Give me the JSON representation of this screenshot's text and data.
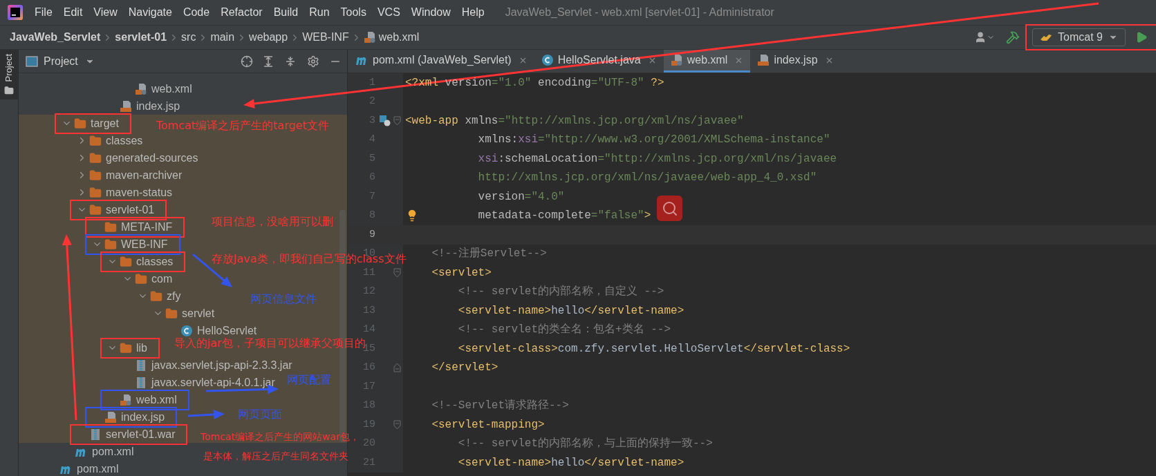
{
  "menu": [
    "File",
    "Edit",
    "View",
    "Navigate",
    "Code",
    "Refactor",
    "Build",
    "Run",
    "Tools",
    "VCS",
    "Window",
    "Help"
  ],
  "window": {
    "title": "JavaWeb_Servlet - web.xml [servlet-01] - Administrator"
  },
  "breadcrumb": [
    {
      "label": "JavaWeb_Servlet",
      "kind": "module"
    },
    {
      "label": "servlet-01",
      "kind": "module"
    },
    {
      "label": "src",
      "kind": "dir"
    },
    {
      "label": "main",
      "kind": "dir"
    },
    {
      "label": "webapp",
      "kind": "dir"
    },
    {
      "label": "WEB-INF",
      "kind": "dir"
    },
    {
      "label": "web.xml",
      "kind": "xml"
    }
  ],
  "run_config": {
    "label": "Tomcat 9",
    "color": "#ff3333"
  },
  "side_stripe": {
    "label": "Project"
  },
  "project_panel": {
    "title": "Project"
  },
  "tree": [
    {
      "children": [
        {
          "children": [
            {
              "children": [
                {
                  "children": [
                    {
                      "children": [
                        {
                          "label": "web.xml",
                          "kind": "xml",
                          "excluded": false
                        }
                      ]
                    },
                    {
                      "label": "index.jsp",
                      "kind": "jsp",
                      "excluded": false
                    }
                  ]
                }
              ]
            }
          ]
        },
        {
          "label": "target",
          "kind": "folder",
          "expanded": true,
          "excluded": true,
          "color": "#ff3333",
          "children": [
            {
              "label": "classes",
              "kind": "folder",
              "expanded": false,
              "excluded": true
            },
            {
              "label": "generated-sources",
              "kind": "folder",
              "expanded": false,
              "excluded": true
            },
            {
              "label": "maven-archiver",
              "kind": "folder",
              "expanded": false,
              "excluded": true
            },
            {
              "label": "maven-status",
              "kind": "folder",
              "expanded": false,
              "excluded": true
            },
            {
              "label": "servlet-01",
              "kind": "folder",
              "expanded": true,
              "excluded": true,
              "color": "#ff3333",
              "children": [
                {
                  "label": "META-INF",
                  "kind": "folder",
                  "excluded": true,
                  "color": "#ff3333"
                },
                {
                  "label": "WEB-INF",
                  "kind": "folder",
                  "expanded": true,
                  "excluded": true,
                  "color": "#3355ee",
                  "children": [
                    {
                      "label": "classes",
                      "kind": "folder",
                      "expanded": true,
                      "excluded": true,
                      "color": "#ff3333",
                      "children": [
                        {
                          "label": "com",
                          "kind": "folder",
                          "expanded": true,
                          "excluded": true,
                          "children": [
                            {
                              "label": "zfy",
                              "kind": "folder",
                              "expanded": true,
                              "excluded": true,
                              "children": [
                                {
                                  "label": "servlet",
                                  "kind": "folder",
                                  "expanded": true,
                                  "excluded": true,
                                  "children": [
                                    {
                                      "label": "HelloServlet",
                                      "kind": "class",
                                      "excluded": true
                                    }
                                  ]
                                }
                              ]
                            }
                          ]
                        }
                      ]
                    },
                    {
                      "label": "lib",
                      "kind": "folder",
                      "expanded": true,
                      "excluded": true,
                      "color": "#ff3333",
                      "children": [
                        {
                          "label": "javax.servlet.jsp-api-2.3.3.jar",
                          "kind": "jar",
                          "excluded": true
                        },
                        {
                          "label": "javax.servlet-api-4.0.1.jar",
                          "kind": "jar",
                          "excluded": true
                        }
                      ]
                    },
                    {
                      "label": "web.xml",
                      "kind": "xml",
                      "excluded": true,
                      "color": "#3355ee"
                    }
                  ]
                },
                {
                  "label": "index.jsp",
                  "kind": "jsp",
                  "excluded": true,
                  "color": "#3355ee"
                }
              ]
            },
            {
              "label": "servlet-01.war",
              "kind": "jar",
              "excluded": true,
              "color": "#ff3333"
            }
          ]
        },
        {
          "label": "pom.xml",
          "kind": "maven",
          "excluded": false
        }
      ]
    },
    {
      "label": "pom.xml",
      "kind": "maven",
      "excluded": false
    }
  ],
  "editor_tabs": [
    {
      "label": "pom.xml (JavaWeb_Servlet)",
      "kind": "maven",
      "selected": false
    },
    {
      "label": "HelloServlet.java",
      "kind": "class",
      "selected": false
    },
    {
      "label": "web.xml",
      "kind": "xml",
      "selected": true
    },
    {
      "label": "index.jsp",
      "kind": "jsp",
      "selected": false
    }
  ],
  "code": [
    {
      "number": "1",
      "current": false,
      "segments": [
        {
          "kind": "tag",
          "text": "<?xml"
        },
        {
          "kind": "attr",
          "text": " version"
        },
        {
          "kind": "value",
          "text": "=\"1.0\""
        },
        {
          "kind": "attr",
          "text": " encoding"
        },
        {
          "kind": "value",
          "text": "=\"UTF-8\""
        },
        {
          "kind": "tag",
          "text": " ?>"
        }
      ]
    },
    {
      "number": "2",
      "current": false
    },
    {
      "number": "3",
      "current": false,
      "segments": [
        {
          "kind": "tag",
          "text": "<web-app"
        },
        {
          "kind": "attr",
          "text": " xmlns"
        },
        {
          "kind": "value",
          "text": "=\"http://xmlns.jcp.org/xml/ns/javaee\""
        }
      ]
    },
    {
      "number": "4",
      "current": false,
      "segments": [
        {
          "kind": "attr",
          "text": "           xmlns:"
        },
        {
          "kind": "ns",
          "text": "xsi"
        },
        {
          "kind": "value",
          "text": "=\"http://www.w3.org/2001/XMLSchema-instance\""
        }
      ]
    },
    {
      "number": "5",
      "current": false,
      "segments": [
        {
          "kind": "ns",
          "text": "           xsi"
        },
        {
          "kind": "attr",
          "text": ":schemaLocation"
        },
        {
          "kind": "value",
          "text": "=\"http://xmlns.jcp.org/xml/ns/javaee"
        }
      ]
    },
    {
      "number": "6",
      "current": false,
      "segments": [
        {
          "kind": "value",
          "text": "           http://xmlns.jcp.org/xml/ns/javaee/web-app_4_0.xsd\""
        }
      ]
    },
    {
      "number": "7",
      "current": false,
      "segments": [
        {
          "kind": "attr",
          "text": "           version"
        },
        {
          "kind": "value",
          "text": "=\"4.0\""
        }
      ]
    },
    {
      "number": "8",
      "current": false,
      "segments": [
        {
          "kind": "attr",
          "text": "           metadata-complete"
        },
        {
          "kind": "value",
          "text": "=\"false\""
        },
        {
          "kind": "tag",
          "text": ">"
        }
      ]
    },
    {
      "number": "9",
      "current": true
    },
    {
      "number": "10",
      "current": false,
      "segments": [
        {
          "kind": "comment",
          "text": "    <!--注册Servlet-->"
        }
      ]
    },
    {
      "number": "11",
      "current": false,
      "segments": [
        {
          "kind": "tag",
          "text": "    <servlet>"
        }
      ]
    },
    {
      "number": "12",
      "current": false,
      "segments": [
        {
          "kind": "comment",
          "text": "        <!-- servlet的内部名称，自定义 -->"
        }
      ]
    },
    {
      "number": "13",
      "current": false,
      "segments": [
        {
          "kind": "tag",
          "text": "        <servlet-name>"
        },
        {
          "kind": "text",
          "text": "hello"
        },
        {
          "kind": "tag",
          "text": "</servlet-name>"
        }
      ]
    },
    {
      "number": "14",
      "current": false,
      "segments": [
        {
          "kind": "comment",
          "text": "        <!-- servlet的类全名：包名+类名 -->"
        }
      ]
    },
    {
      "number": "15",
      "current": false,
      "segments": [
        {
          "kind": "tag",
          "text": "        <servlet-class>"
        },
        {
          "kind": "text",
          "text": "com.zfy.servlet.HelloServlet"
        },
        {
          "kind": "tag",
          "text": "</servlet-class>"
        }
      ]
    },
    {
      "number": "16",
      "current": false,
      "segments": [
        {
          "kind": "tag",
          "text": "    </servlet>"
        }
      ]
    },
    {
      "number": "17",
      "current": false
    },
    {
      "number": "18",
      "current": false,
      "segments": [
        {
          "kind": "comment",
          "text": "    <!--Servlet请求路径-->"
        }
      ]
    },
    {
      "number": "19",
      "current": false,
      "segments": [
        {
          "kind": "tag",
          "text": "    <servlet-mapping>"
        }
      ]
    },
    {
      "number": "20",
      "current": false,
      "segments": [
        {
          "kind": "comment",
          "text": "        <!-- servlet的内部名称，与上面的保持一致-->"
        }
      ]
    },
    {
      "number": "21",
      "current": false,
      "segments": [
        {
          "kind": "tag",
          "text": "        <servlet-name>"
        },
        {
          "kind": "text",
          "text": "hello"
        },
        {
          "kind": "tag",
          "text": "</servlet-name>"
        }
      ]
    }
  ],
  "annotations": [
    {
      "text": "Tomcat编译之后产生的target文件",
      "color": "#ff3333"
    },
    {
      "text": "项目信息，没啥用可以删",
      "color": "#ff3333"
    },
    {
      "text": "存放Java类，即我们自己写的class文件",
      "color": "#ff3333"
    },
    {
      "text": "网页信息文件",
      "color": "#3355ee"
    },
    {
      "text": "导入的jar包，子项目可以继承父项目的",
      "color": "#ff3333"
    },
    {
      "text": "网页配置",
      "color": "#3355ee"
    },
    {
      "text": "网页页面",
      "color": "#3355ee"
    },
    {
      "text": "Tomcat编译之后产生的网站war包，",
      "color": "#ff3333"
    },
    {
      "text": "是本体，解压之后产生同名文件夹",
      "color": "#ff3333"
    }
  ]
}
